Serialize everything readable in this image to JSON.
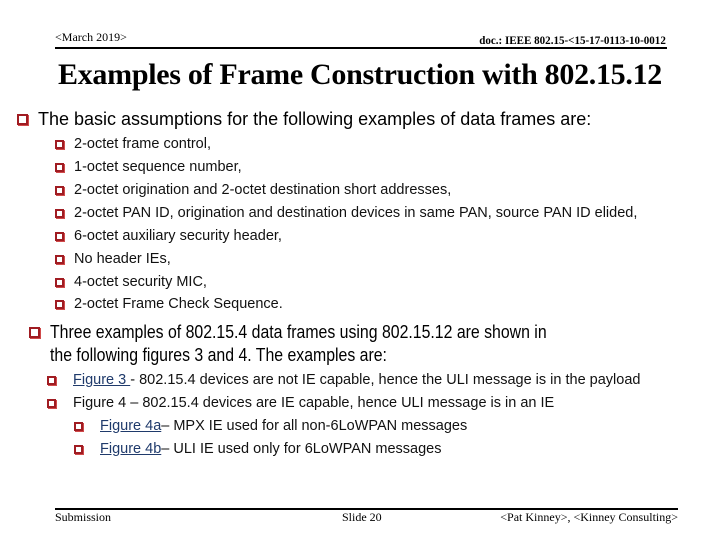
{
  "header": {
    "date": "<March 2019>",
    "doc_id": "doc.: IEEE 802.15-<15-17-0113-10-0012"
  },
  "title": "Examples of Frame Construction with 802.15.12",
  "section1": {
    "heading": "The basic assumptions for the following examples of data frames are:",
    "items": [
      "2-octet frame control,",
      "1-octet sequence number,",
      "2-octet origination and 2-octet destination short addresses,",
      "2-octet PAN ID, origination and destination devices in same PAN, source PAN ID elided,",
      "6-octet auxiliary security header,",
      "No header IEs,",
      "4-octet security MIC,",
      "2-octet Frame Check Sequence."
    ]
  },
  "section2": {
    "heading_line1": "Three examples of 802.15.4 data frames using 802.15.12 are shown in",
    "heading_line2": "the following figures 3 and 4.  The examples are:",
    "items": [
      {
        "link": "Figure 3 ",
        "text": "- 802.15.4 devices are not IE capable, hence the ULI message is in the payload"
      },
      {
        "link": "",
        "text": "Figure 4 – 802.15.4 devices are IE capable, hence ULI message is in an IE"
      }
    ],
    "subitems": [
      {
        "link": "Figure 4a",
        "text": "– MPX IE used for all non-6LoWPAN messages"
      },
      {
        "link": "Figure 4b",
        "text": "– ULI IE used only for 6LoWPAN messages"
      }
    ]
  },
  "footer": {
    "left": "Submission",
    "center": "Slide 20",
    "right": "<Pat Kinney>, <Kinney Consulting>"
  },
  "colors": {
    "bullet": "#a01c22",
    "link": "#1f3a6b"
  }
}
